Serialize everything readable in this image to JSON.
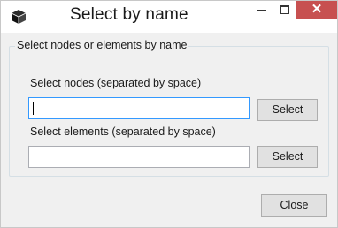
{
  "window": {
    "title": "Select by name",
    "icon": "cube-icon",
    "controls": {
      "minimize": "minimize-icon",
      "maximize": "maximize-icon",
      "close_glyph": "✕"
    }
  },
  "group": {
    "legend": "Select nodes or elements by name"
  },
  "nodes": {
    "label": "Select nodes (separated by space)",
    "value": "",
    "button_label": "Select"
  },
  "elements": {
    "label": "Select elements (separated by space)",
    "value": "",
    "button_label": "Select"
  },
  "footer": {
    "close_label": "Close"
  },
  "colors": {
    "window_bg": "#f0f0f0",
    "titlebar_bg": "#ffffff",
    "close_button_bg": "#c75050",
    "focus_border": "#3399ff",
    "button_bg": "#e1e1e1"
  }
}
